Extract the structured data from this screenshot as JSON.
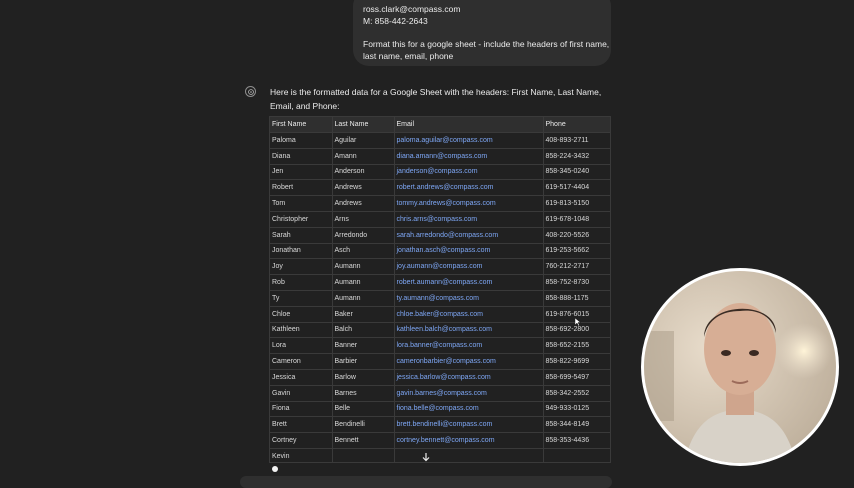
{
  "user_message": {
    "email_line": "ross.clark@compass.com",
    "mobile_line": "M: 858-442-2643",
    "prompt_line1": "Format this for a google sheet - include the headers of first name,",
    "prompt_line2": "last name, email, phone"
  },
  "assistant": {
    "avatar_icon": "assistant-logo-icon",
    "intro_text": "Here is the formatted data for a Google Sheet with the headers: First Name, Last Name, Email, and Phone:"
  },
  "table": {
    "headers": [
      "First Name",
      "Last Name",
      "Email",
      "Phone"
    ],
    "rows": [
      [
        "Paloma",
        "Aguilar",
        "paloma.aguilar@compass.com",
        "408-893-2711"
      ],
      [
        "Diana",
        "Amann",
        "diana.amann@compass.com",
        "858-224-3432"
      ],
      [
        "Jen",
        "Anderson",
        "janderson@compass.com",
        "858-345-0240"
      ],
      [
        "Robert",
        "Andrews",
        "robert.andrews@compass.com",
        "619-517-4404"
      ],
      [
        "Tom",
        "Andrews",
        "tommy.andrews@compass.com",
        "619-813-5150"
      ],
      [
        "Christopher",
        "Arns",
        "chris.arns@compass.com",
        "619-678-1048"
      ],
      [
        "Sarah",
        "Arredondo",
        "sarah.arredondo@compass.com",
        "408-220-5526"
      ],
      [
        "Jonathan",
        "Asch",
        "jonathan.asch@compass.com",
        "619-253-5662"
      ],
      [
        "Joy",
        "Aumann",
        "joy.aumann@compass.com",
        "760-212-2717"
      ],
      [
        "Rob",
        "Aumann",
        "robert.aumann@compass.com",
        "858-752-8730"
      ],
      [
        "Ty",
        "Aumann",
        "ty.aumann@compass.com",
        "858-888-1175"
      ],
      [
        "Chloe",
        "Baker",
        "chloe.baker@compass.com",
        "619-876-6015"
      ],
      [
        "Kathleen",
        "Balch",
        "kathleen.balch@compass.com",
        "858-692-2800"
      ],
      [
        "Lora",
        "Banner",
        "lora.banner@compass.com",
        "858-652-2155"
      ],
      [
        "Cameron",
        "Barbier",
        "cameronbarbier@compass.com",
        "858-822-9699"
      ],
      [
        "Jessica",
        "Barlow",
        "jessica.barlow@compass.com",
        "858-699-5497"
      ],
      [
        "Gavin",
        "Barnes",
        "gavin.barnes@compass.com",
        "858-342-2552"
      ],
      [
        "Fiona",
        "Belle",
        "fiona.belle@compass.com",
        "949-933-0125"
      ],
      [
        "Brett",
        "Bendinelli",
        "brett.bendinelli@compass.com",
        "858-344-8149"
      ],
      [
        "Cortney",
        "Bennett",
        "cortney.bennett@compass.com",
        "858-353-4436"
      ],
      [
        "Kevin",
        "",
        "",
        ""
      ]
    ]
  },
  "controls": {
    "scroll_down_icon": "arrow-down-icon"
  },
  "colors": {
    "background": "#212121",
    "bubble": "#2f2f2f",
    "link": "#7ea7f5",
    "text": "#ececec"
  }
}
